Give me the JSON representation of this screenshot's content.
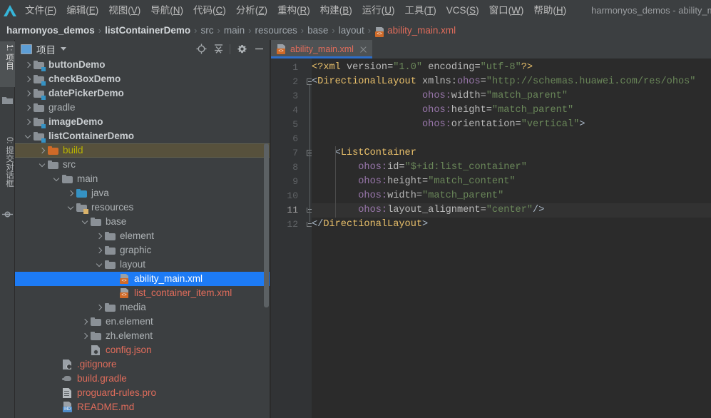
{
  "window": {
    "title": "harmonyos_demos - ability_main.xml [listCont",
    "logo_icon": "harmonyos-ide-logo-icon"
  },
  "menubar": {
    "items": [
      {
        "name": "文件",
        "key": "F"
      },
      {
        "name": "编辑",
        "key": "E"
      },
      {
        "name": "视图",
        "key": "V"
      },
      {
        "name": "导航",
        "key": "N"
      },
      {
        "name": "代码",
        "key": "C"
      },
      {
        "name": "分析",
        "key": "Z"
      },
      {
        "name": "重构",
        "key": "R"
      },
      {
        "name": "构建",
        "key": "B"
      },
      {
        "name": "运行",
        "key": "U"
      },
      {
        "name": "工具",
        "key": "T"
      },
      {
        "name": "VCS",
        "key": "S"
      },
      {
        "name": "窗口",
        "key": "W"
      },
      {
        "name": "帮助",
        "key": "H"
      }
    ]
  },
  "breadcrumb": {
    "items": [
      {
        "label": "harmonyos_demos",
        "style": "bold"
      },
      {
        "label": "listContainerDemo",
        "style": "bold"
      },
      {
        "label": "src",
        "style": "plain"
      },
      {
        "label": "main",
        "style": "plain"
      },
      {
        "label": "resources",
        "style": "plain"
      },
      {
        "label": "base",
        "style": "plain"
      },
      {
        "label": "layout",
        "style": "plain"
      },
      {
        "label": "ability_main.xml",
        "style": "file"
      }
    ],
    "separator": "›"
  },
  "toolstrip": {
    "project_tab": "1: 项目",
    "commit_tab": "0: 提交对话框",
    "folder_icon": "folder-icon",
    "commit_icon": "commit-icon"
  },
  "project_panel": {
    "title": "项目",
    "title_icon": "project-view-icon",
    "dropdown_icon": "chevron-down-icon",
    "tools": [
      {
        "name": "locate-icon",
        "title": "Select Opened File"
      },
      {
        "name": "collapse-all-icon",
        "title": "Collapse All"
      },
      {
        "name": "settings-gear-icon",
        "title": "Settings"
      },
      {
        "name": "hide-panel-icon",
        "title": "Hide"
      }
    ],
    "tree": [
      {
        "label": "buttonDemo",
        "indent": 1,
        "arrow": "right",
        "icon": "module-folder-icon",
        "style": "bold"
      },
      {
        "label": "checkBoxDemo",
        "indent": 1,
        "arrow": "right",
        "icon": "module-folder-icon",
        "style": "bold"
      },
      {
        "label": "datePickerDemo",
        "indent": 1,
        "arrow": "right",
        "icon": "module-folder-icon",
        "style": "bold"
      },
      {
        "label": "gradle",
        "indent": 1,
        "arrow": "right",
        "icon": "folder-icon",
        "style": "gray"
      },
      {
        "label": "imageDemo",
        "indent": 1,
        "arrow": "right",
        "icon": "module-folder-icon",
        "style": "bold"
      },
      {
        "label": "listContainerDemo",
        "indent": 1,
        "arrow": "down",
        "icon": "module-folder-icon",
        "style": "bold"
      },
      {
        "label": "build",
        "indent": 2,
        "arrow": "right",
        "icon": "build-folder-icon",
        "style": "olive",
        "highlight": "build"
      },
      {
        "label": "src",
        "indent": 2,
        "arrow": "down",
        "icon": "folder-icon",
        "style": "gray"
      },
      {
        "label": "main",
        "indent": 3,
        "arrow": "down",
        "icon": "folder-icon",
        "style": "gray"
      },
      {
        "label": "java",
        "indent": 4,
        "arrow": "right",
        "icon": "source-folder-icon",
        "style": "gray"
      },
      {
        "label": "resources",
        "indent": 4,
        "arrow": "down",
        "icon": "resource-folder-icon",
        "style": "gray"
      },
      {
        "label": "base",
        "indent": 5,
        "arrow": "down",
        "icon": "folder-icon",
        "style": "gray"
      },
      {
        "label": "element",
        "indent": 6,
        "arrow": "right",
        "icon": "folder-icon",
        "style": "gray"
      },
      {
        "label": "graphic",
        "indent": 6,
        "arrow": "right",
        "icon": "folder-icon",
        "style": "gray"
      },
      {
        "label": "layout",
        "indent": 6,
        "arrow": "down",
        "icon": "folder-icon",
        "style": "gray"
      },
      {
        "label": "ability_main.xml",
        "indent": 7,
        "arrow": "none",
        "icon": "xml-file-icon",
        "style": "salmon",
        "highlight": "selected"
      },
      {
        "label": "list_container_item.xml",
        "indent": 7,
        "arrow": "none",
        "icon": "xml-file-icon",
        "style": "salmon"
      },
      {
        "label": "media",
        "indent": 6,
        "arrow": "right",
        "icon": "folder-icon",
        "style": "gray"
      },
      {
        "label": "en.element",
        "indent": 5,
        "arrow": "right",
        "icon": "folder-icon",
        "style": "gray"
      },
      {
        "label": "zh.element",
        "indent": 5,
        "arrow": "right",
        "icon": "folder-icon",
        "style": "gray"
      },
      {
        "label": "config.json",
        "indent": 5,
        "arrow": "none",
        "icon": "json-file-icon",
        "style": "salmon"
      },
      {
        "label": ".gitignore",
        "indent": 3,
        "arrow": "none",
        "icon": "gitignore-file-icon",
        "style": "salmon"
      },
      {
        "label": "build.gradle",
        "indent": 3,
        "arrow": "none",
        "icon": "gradle-file-icon",
        "style": "salmon"
      },
      {
        "label": "proguard-rules.pro",
        "indent": 3,
        "arrow": "none",
        "icon": "pro-file-icon",
        "style": "salmon"
      },
      {
        "label": "README.md",
        "indent": 3,
        "arrow": "none",
        "icon": "markdown-file-icon",
        "style": "salmon"
      }
    ]
  },
  "editor": {
    "tab": {
      "label": "ability_main.xml",
      "icon": "xml-file-icon",
      "close_icon": "close-icon"
    },
    "current_line": 11,
    "lines": [
      {
        "n": 1,
        "fold": "none",
        "tokens": [
          {
            "t": "decl",
            "s": "<?xml "
          },
          {
            "t": "attr",
            "s": "version"
          },
          {
            "t": "eq",
            "s": "="
          },
          {
            "t": "val",
            "s": "\"1.0\""
          },
          {
            "t": "attr",
            "s": " encoding"
          },
          {
            "t": "eq",
            "s": "="
          },
          {
            "t": "val",
            "s": "\"utf-8\""
          },
          {
            "t": "decl",
            "s": "?>"
          }
        ]
      },
      {
        "n": 2,
        "fold": "start",
        "tokens": [
          {
            "t": "punct",
            "s": "<"
          },
          {
            "t": "tag",
            "s": "DirectionalLayout"
          },
          {
            "t": "attr",
            "s": " xmlns:"
          },
          {
            "t": "ns",
            "s": "ohos"
          },
          {
            "t": "eq",
            "s": "="
          },
          {
            "t": "val",
            "s": "\"http://schemas.huawei.com/res/ohos\""
          }
        ]
      },
      {
        "n": 3,
        "fold": "none",
        "tokens": [
          {
            "t": "plain",
            "s": "                   "
          },
          {
            "t": "ns",
            "s": "ohos:"
          },
          {
            "t": "attr",
            "s": "width"
          },
          {
            "t": "eq",
            "s": "="
          },
          {
            "t": "val",
            "s": "\"match_parent\""
          }
        ]
      },
      {
        "n": 4,
        "fold": "none",
        "tokens": [
          {
            "t": "plain",
            "s": "                   "
          },
          {
            "t": "ns",
            "s": "ohos:"
          },
          {
            "t": "attr",
            "s": "height"
          },
          {
            "t": "eq",
            "s": "="
          },
          {
            "t": "val",
            "s": "\"match_parent\""
          }
        ]
      },
      {
        "n": 5,
        "fold": "none",
        "tokens": [
          {
            "t": "plain",
            "s": "                   "
          },
          {
            "t": "ns",
            "s": "ohos:"
          },
          {
            "t": "attr",
            "s": "orientation"
          },
          {
            "t": "eq",
            "s": "="
          },
          {
            "t": "val",
            "s": "\"vertical\""
          },
          {
            "t": "punct",
            "s": ">"
          }
        ]
      },
      {
        "n": 6,
        "fold": "none",
        "tokens": []
      },
      {
        "n": 7,
        "fold": "start",
        "tokens": [
          {
            "t": "plain",
            "s": "    "
          },
          {
            "t": "punct",
            "s": "<"
          },
          {
            "t": "tag",
            "s": "ListContainer"
          }
        ]
      },
      {
        "n": 8,
        "fold": "none",
        "tokens": [
          {
            "t": "plain",
            "s": "        "
          },
          {
            "t": "ns",
            "s": "ohos:"
          },
          {
            "t": "attr",
            "s": "id"
          },
          {
            "t": "eq",
            "s": "="
          },
          {
            "t": "val",
            "s": "\"$+id:list_container\""
          }
        ]
      },
      {
        "n": 9,
        "fold": "none",
        "tokens": [
          {
            "t": "plain",
            "s": "        "
          },
          {
            "t": "ns",
            "s": "ohos:"
          },
          {
            "t": "attr",
            "s": "height"
          },
          {
            "t": "eq",
            "s": "="
          },
          {
            "t": "val",
            "s": "\"match_content\""
          }
        ]
      },
      {
        "n": 10,
        "fold": "none",
        "tokens": [
          {
            "t": "plain",
            "s": "        "
          },
          {
            "t": "ns",
            "s": "ohos:"
          },
          {
            "t": "attr",
            "s": "width"
          },
          {
            "t": "eq",
            "s": "="
          },
          {
            "t": "val",
            "s": "\"match_parent\""
          }
        ]
      },
      {
        "n": 11,
        "fold": "end",
        "tokens": [
          {
            "t": "plain",
            "s": "        "
          },
          {
            "t": "ns",
            "s": "ohos:"
          },
          {
            "t": "attr",
            "s": "layout_alignment"
          },
          {
            "t": "eq",
            "s": "="
          },
          {
            "t": "val",
            "s": "\"center\""
          },
          {
            "t": "punct",
            "s": "/>"
          }
        ]
      },
      {
        "n": 12,
        "fold": "end",
        "tokens": [
          {
            "t": "punct",
            "s": "</"
          },
          {
            "t": "tag",
            "s": "DirectionalLayout"
          },
          {
            "t": "punct",
            "s": ">"
          }
        ]
      }
    ]
  },
  "colors": {
    "chrome_bg": "#3c3f41",
    "editor_bg": "#2b2b2b",
    "gutter_bg": "#313335",
    "selection_blue": "#1d7bf5",
    "build_highlight": "#57513c",
    "tab_underline": "#2d6ec9",
    "file_salmon": "#e06c5b",
    "tag_gold": "#e8bf6a",
    "ns_purple": "#9876aa",
    "value_green": "#6a8759",
    "text_gray": "#bbbbbb"
  }
}
